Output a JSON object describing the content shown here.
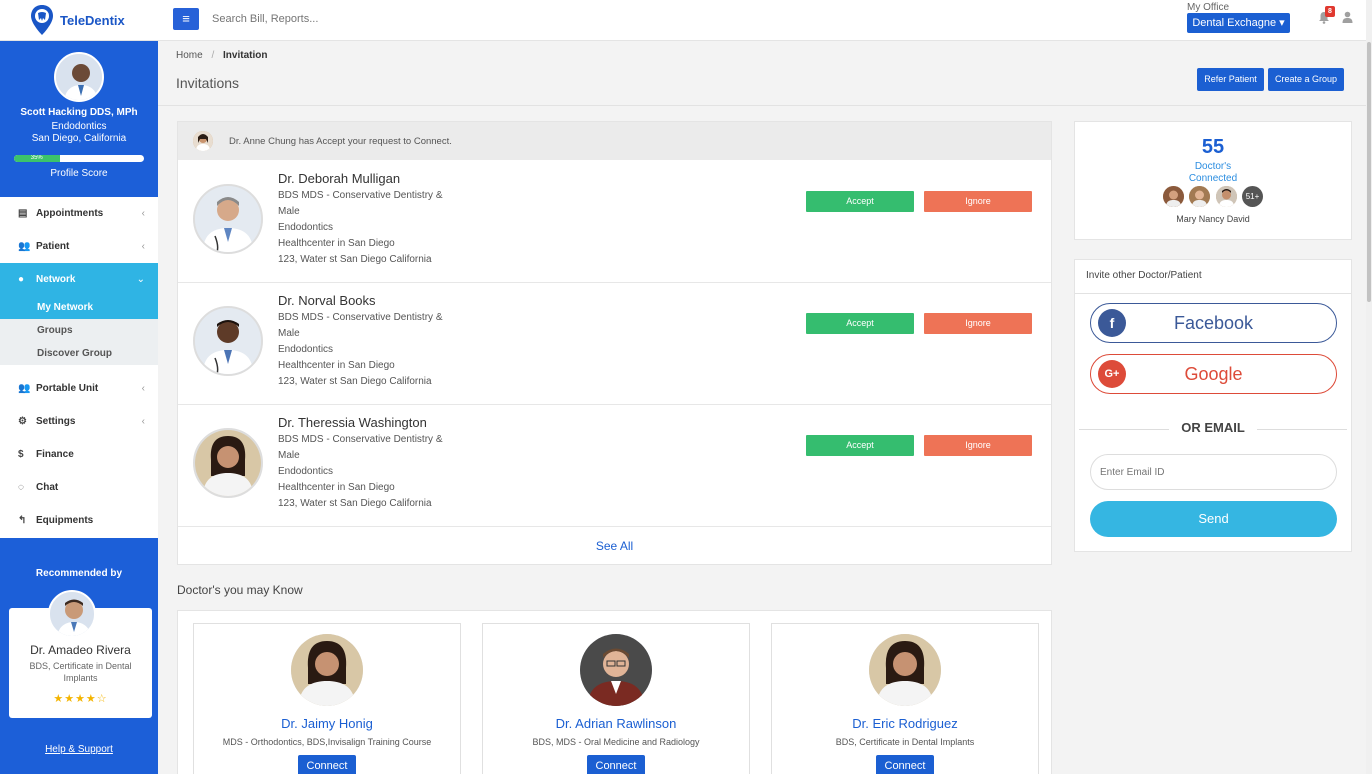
{
  "app": {
    "brand": "TeleDentix"
  },
  "topbar": {
    "search_placeholder": "Search Bill, Reports...",
    "office_label": "My Office",
    "office_value": "Dental Exchagne ▾",
    "notification_count": "8"
  },
  "profile": {
    "name": "Scott Hacking DDS, MPh",
    "specialty": "Endodontics",
    "location": "San Diego, California",
    "score_percent": 35,
    "score_label": "35%",
    "score_caption": "Profile Score"
  },
  "sidebar": {
    "items": [
      {
        "label": "Appointments"
      },
      {
        "label": "Patient"
      },
      {
        "label": "Network"
      },
      {
        "label": "Portable Unit"
      },
      {
        "label": "Settings"
      },
      {
        "label": "Finance"
      },
      {
        "label": "Chat"
      },
      {
        "label": "Equipments"
      }
    ],
    "network_sub": [
      {
        "label": "My Network"
      },
      {
        "label": "Groups"
      },
      {
        "label": "Discover Group"
      }
    ]
  },
  "recommended": {
    "title": "Recommended by",
    "name": "Dr. Amadeo Rivera",
    "degree": "BDS, Certificate in Dental Implants",
    "rating": 4,
    "stars": "★★★★☆",
    "help_link": "Help & Support"
  },
  "breadcrumb": {
    "home": "Home",
    "sep": "/",
    "current": "Invitation"
  },
  "page": {
    "title": "Invitations",
    "refer_button": "Refer Patient",
    "group_button": "Create a Group"
  },
  "notification": {
    "text": "Dr. Anne Chung has Accept your request to Connect."
  },
  "invitations": [
    {
      "name": "Dr. Deborah Mulligan",
      "degree": "BDS MDS - Conservative Dentistry &",
      "gender": "Male",
      "specialty": "Endodontics",
      "center": "Healthcenter in San Diego",
      "address": "123, Water st San Diego California",
      "accept": "Accept",
      "ignore": "Ignore"
    },
    {
      "name": "Dr. Norval Books",
      "degree": "BDS MDS - Conservative Dentistry &",
      "gender": "Male",
      "specialty": "Endodontics",
      "center": "Healthcenter in San Diego",
      "address": "123, Water st San Diego California",
      "accept": "Accept",
      "ignore": "Ignore"
    },
    {
      "name": "Dr. Theressia Washington",
      "degree": "BDS MDS - Conservative Dentistry &",
      "gender": "Male",
      "specialty": "Endodontics",
      "center": "Healthcenter in San Diego",
      "address": "123, Water st San Diego California",
      "accept": "Accept",
      "ignore": "Ignore"
    }
  ],
  "see_all": "See All",
  "know": {
    "title": "Doctor's you may Know",
    "doctors": [
      {
        "name": "Dr. Jaimy Honig",
        "degree": "MDS - Orthodontics, BDS,Invisalign Training Course",
        "button": "Connect"
      },
      {
        "name": "Dr. Adrian Rawlinson",
        "degree": "BDS, MDS - Oral Medicine and Radiology",
        "button": "Connect"
      },
      {
        "name": "Dr. Eric Rodriguez",
        "degree": "BDS, Certificate in Dental Implants",
        "button": "Connect"
      }
    ]
  },
  "stats": {
    "count": "55",
    "label_line1": "Doctor's",
    "label_line2": "Connected",
    "more": "51+",
    "names": "Mary Nancy David"
  },
  "invite": {
    "title": "Invite other Doctor/Patient",
    "facebook": "Facebook",
    "google": "Google",
    "or_email": "OR EMAIL",
    "email_placeholder": "Enter Email ID",
    "send": "Send"
  },
  "colors": {
    "primary": "#1b5fd2",
    "sidebar_active": "#2fb4e4",
    "accept": "#35bd6f",
    "ignore": "#ee7356",
    "facebook": "#3b5998",
    "google": "#dd4b39"
  }
}
